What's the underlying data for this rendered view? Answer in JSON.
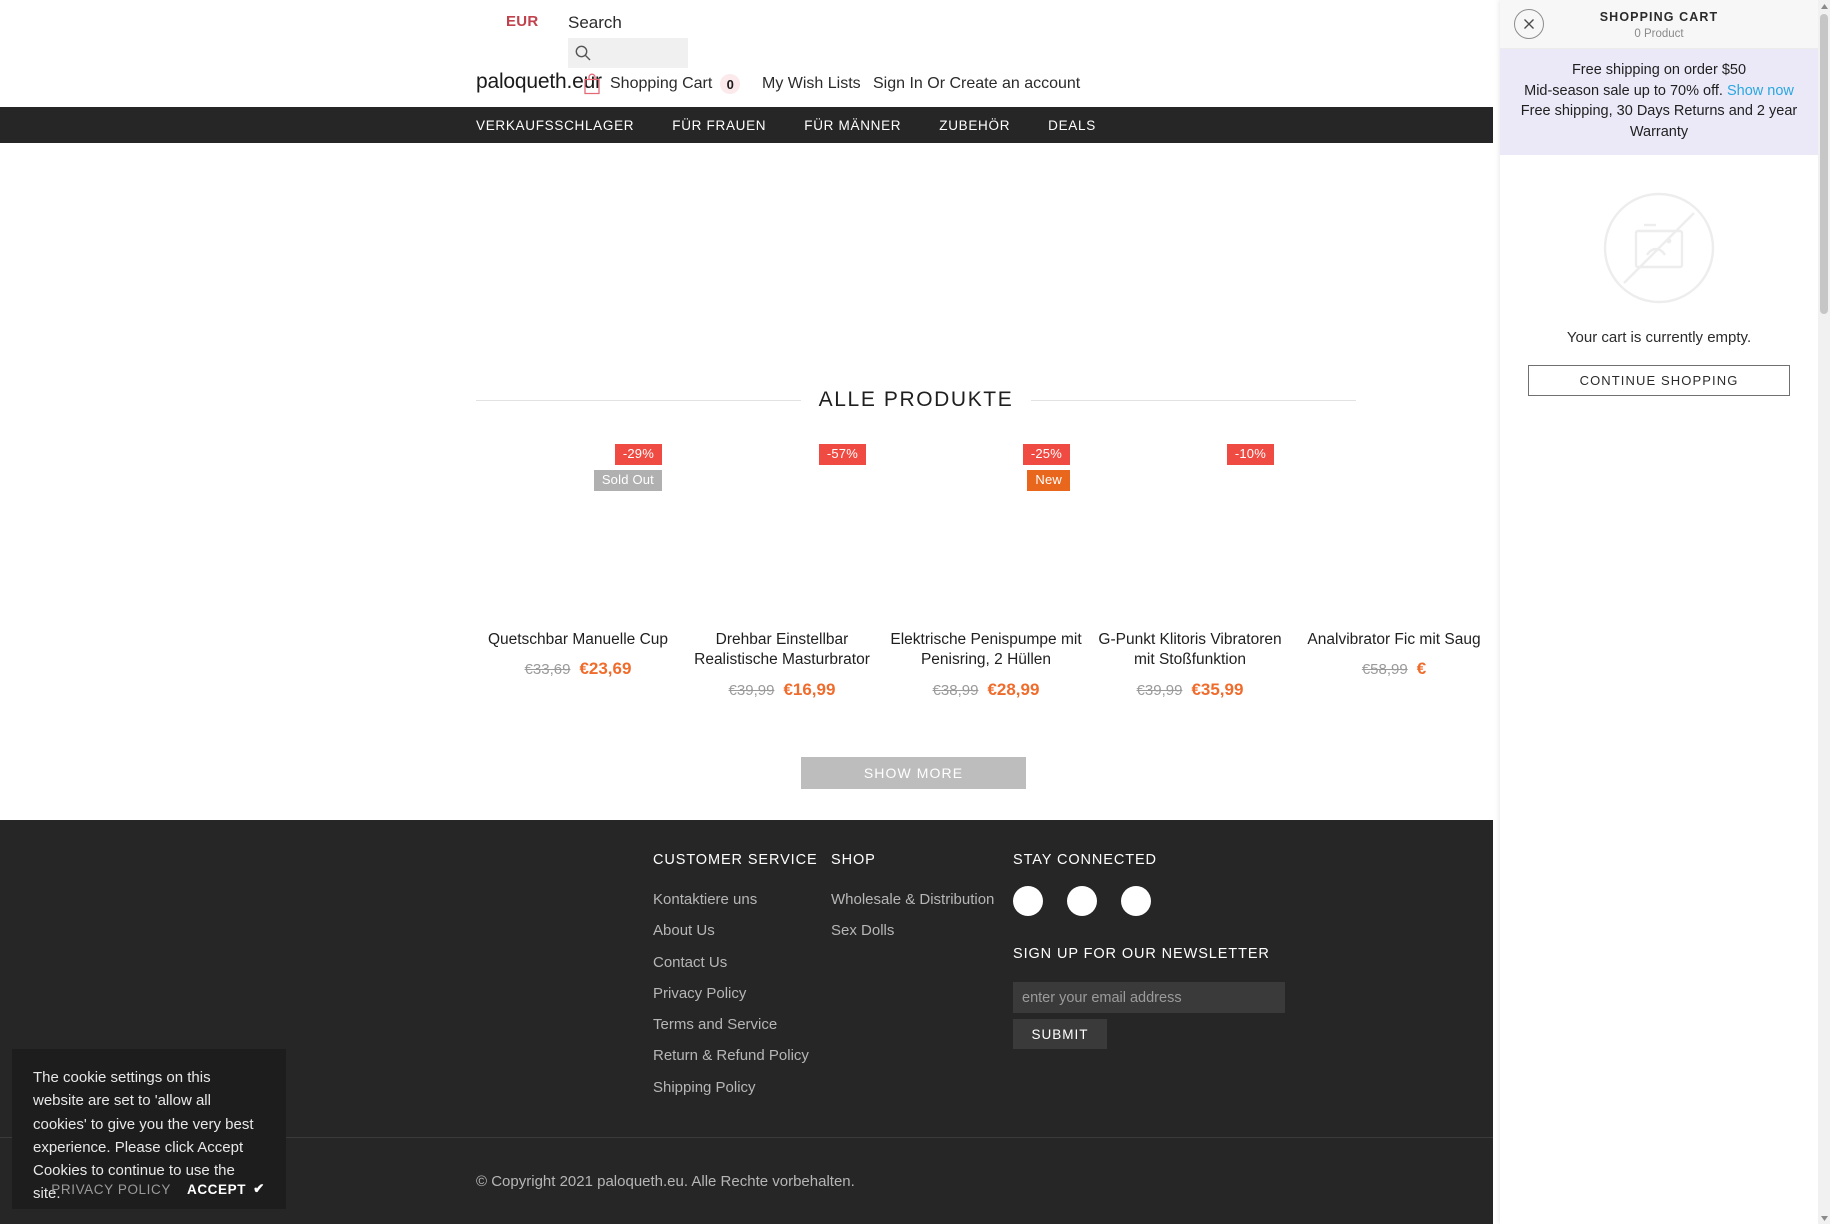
{
  "header": {
    "currency": "EUR",
    "search_label": "Search",
    "search_placeholder": "",
    "search_value": "",
    "search_icon": "search-icon",
    "brand": "paloqueth.eur",
    "cart_icon": "shopping-bag-icon",
    "cart_label": "Shopping Cart",
    "cart_count": "0",
    "wishlist": "My Wish Lists",
    "account": "Sign In Or Create an account"
  },
  "nav": {
    "items": [
      {
        "label": "VERKAUFSSCHLAGER"
      },
      {
        "label": "FÜR FRAUEN"
      },
      {
        "label": "FÜR MÄNNER"
      },
      {
        "label": "ZUBEHÖR"
      },
      {
        "label": "DEALS"
      }
    ]
  },
  "main": {
    "section_title": "ALLE PRODUKTE",
    "show_more": "SHOW MORE",
    "products": [
      {
        "title": "Quetschbar Manuelle Cup",
        "price_old": "€33,69",
        "price_new": "€23,69",
        "badges": [
          {
            "text": "-29%",
            "kind": "sale"
          },
          {
            "text": "Sold Out",
            "kind": "soldout"
          }
        ]
      },
      {
        "title": "Drehbar Einstellbar Realistische Masturbrator",
        "price_old": "€39,99",
        "price_new": "€16,99",
        "badges": [
          {
            "text": "-57%",
            "kind": "sale"
          }
        ]
      },
      {
        "title": "Elektrische Penispumpe mit Penisring, 2 Hüllen",
        "price_old": "€38,99",
        "price_new": "€28,99",
        "badges": [
          {
            "text": "-25%",
            "kind": "sale"
          },
          {
            "text": "New",
            "kind": "new"
          }
        ]
      },
      {
        "title": "G-Punkt Klitoris Vibratoren mit Stoßfunktion",
        "price_old": "€39,99",
        "price_new": "€35,99",
        "badges": [
          {
            "text": "-10%",
            "kind": "sale"
          }
        ]
      },
      {
        "title": "Analvibrator Fic mit Saug",
        "price_old": "€58,99",
        "price_new": "€",
        "badges": []
      }
    ]
  },
  "footer": {
    "customer_service": {
      "title": "CUSTOMER SERVICE",
      "links": [
        "Kontaktiere uns",
        "About Us",
        "Contact Us",
        "Privacy Policy",
        "Terms and Service",
        "Return & Refund Policy",
        "Shipping Policy"
      ]
    },
    "shop": {
      "title": "SHOP",
      "links": [
        "Wholesale & Distribution",
        "Sex Dolls"
      ]
    },
    "social": {
      "title": "STAY CONNECTED",
      "icons": [
        "facebook-icon",
        "twitter-icon",
        "instagram-icon"
      ]
    },
    "newsletter": {
      "title": "SIGN UP FOR OUR NEWSLETTER",
      "placeholder": "enter your email address",
      "value": "",
      "submit": "SUBMIT"
    },
    "copyright": "© Copyright 2021 paloqueth.eu. Alle Rechte vorbehalten."
  },
  "cookie": {
    "text": "The cookie settings on this website are set to 'allow all cookies' to give you the very best experience. Please click Accept Cookies to continue to use the site.",
    "privacy": "PRIVACY POLICY",
    "accept": "ACCEPT",
    "accept_mark": "✔"
  },
  "cart_drawer": {
    "close_icon": "close-icon",
    "title": "SHOPPING CART",
    "count": "0 Product",
    "promo": {
      "line1": "Free shipping on order $50",
      "line2_prefix": "Mid-season sale up to 70% off. ",
      "line2_link": "Show now",
      "line3": "Free shipping, 30 Days Returns and 2 year Warranty"
    },
    "empty_icon": "no-image-icon",
    "empty_text": "Your cart is currently empty.",
    "continue_label": "CONTINUE SHOPPING"
  },
  "colors": {
    "accent_red": "#ef4b42",
    "accent_orange": "#ef6c2c",
    "brand_currency": "#c0424c",
    "nav_bg": "#262626",
    "promo_bg": "#ebe9f7",
    "promo_link": "#2aa7e0"
  }
}
